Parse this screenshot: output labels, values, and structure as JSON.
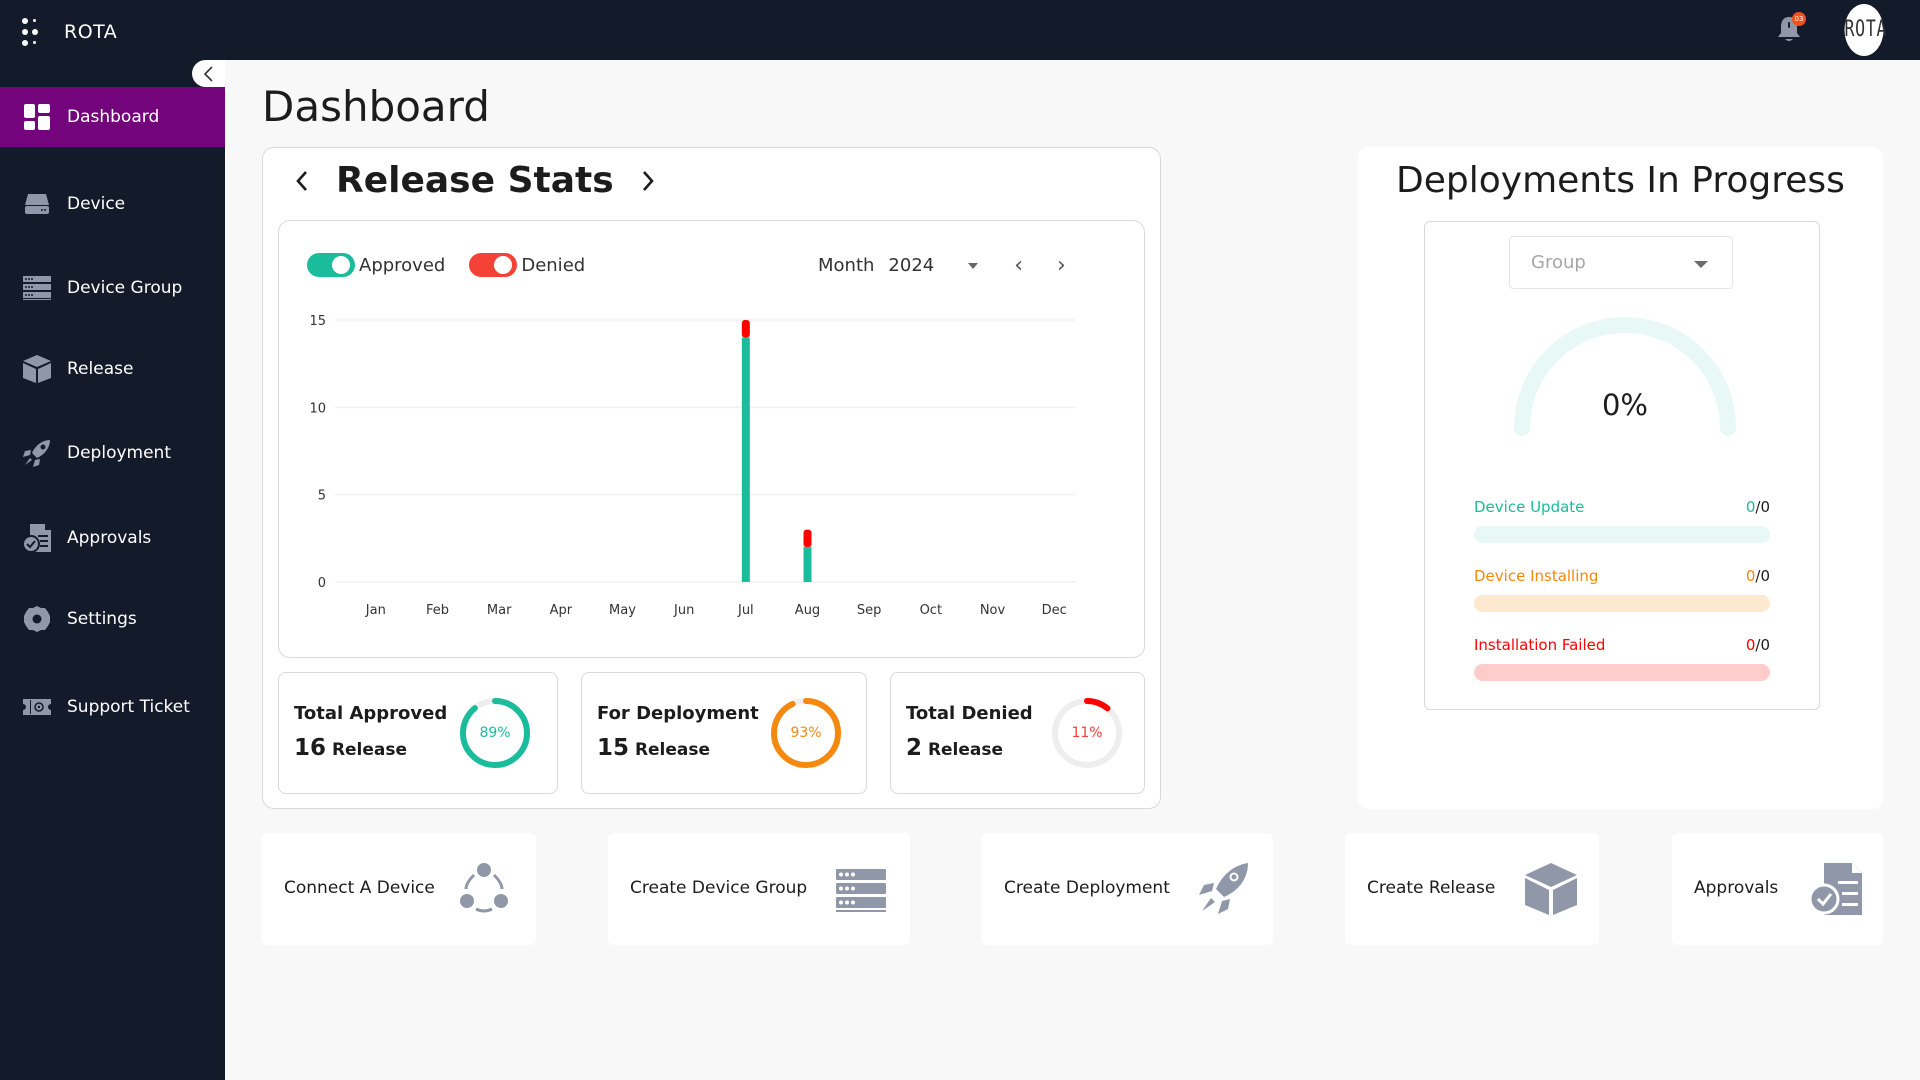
{
  "app": {
    "brand": "ROTA",
    "avatar_text": "ROTA",
    "notification_count": "03"
  },
  "sidebar": {
    "items": [
      {
        "label": "Dashboard",
        "icon": "dashboard-icon",
        "active": true
      },
      {
        "label": "Device",
        "icon": "device-icon",
        "active": false
      },
      {
        "label": "Device Group",
        "icon": "device-group-icon",
        "active": false
      },
      {
        "label": "Release",
        "icon": "release-box-icon",
        "active": false
      },
      {
        "label": "Deployment",
        "icon": "rocket-icon",
        "active": false
      },
      {
        "label": "Approvals",
        "icon": "approvals-icon",
        "active": false
      },
      {
        "label": "Settings",
        "icon": "gear-icon",
        "active": false
      },
      {
        "label": "Support Ticket",
        "icon": "ticket-icon",
        "active": false
      }
    ]
  },
  "page": {
    "title": "Dashboard"
  },
  "release_stats": {
    "title": "Release Stats",
    "legend": {
      "approved": "Approved",
      "denied": "Denied"
    },
    "period_label": "Month",
    "year": "2024",
    "cards": [
      {
        "label": "Total Approved",
        "count": "16",
        "unit": "Release",
        "percent": 89,
        "percent_text": "89%",
        "color": "#1abc9c"
      },
      {
        "label": "For Deployment",
        "count": "15",
        "unit": "Release",
        "percent": 93,
        "percent_text": "93%",
        "color": "#f5880f"
      },
      {
        "label": "Total Denied",
        "count": "2",
        "unit": "Release",
        "percent": 11,
        "percent_text": "11%",
        "color": "#ff0000"
      }
    ]
  },
  "chart_data": {
    "type": "bar",
    "stacked": true,
    "title": "Release Stats",
    "categories": [
      "Jan",
      "Feb",
      "Mar",
      "Apr",
      "May",
      "Jun",
      "Jul",
      "Aug",
      "Sep",
      "Oct",
      "Nov",
      "Dec"
    ],
    "series": [
      {
        "name": "Approved",
        "color": "#1abc9c",
        "values": [
          0,
          0,
          0,
          0,
          0,
          0,
          14,
          2,
          0,
          0,
          0,
          0
        ]
      },
      {
        "name": "Denied",
        "color": "#ff0000",
        "values": [
          0,
          0,
          0,
          0,
          0,
          0,
          1,
          1,
          0,
          0,
          0,
          0
        ]
      }
    ],
    "yticks": [
      0,
      5,
      10,
      15
    ],
    "ylim": [
      0,
      15
    ],
    "xlabel": "",
    "ylabel": "",
    "grid": true,
    "legend": "top-left"
  },
  "deployments": {
    "title": "Deployments In Progress",
    "group_placeholder": "Group",
    "gauge_percent": 0,
    "gauge_text": "0%",
    "progress": [
      {
        "label": "Device Update",
        "done": "0",
        "total": "0",
        "fraction": 0,
        "color": "#1abc9c",
        "track": "#e8f8f5"
      },
      {
        "label": "Device Installing",
        "done": "0",
        "total": "0",
        "fraction": 0,
        "color": "#f5880f",
        "track": "#fde8d0"
      },
      {
        "label": "Installation Failed",
        "done": "0",
        "total": "0",
        "fraction": 0,
        "color": "#ff0000",
        "track": "#ffcccc"
      }
    ]
  },
  "quick_actions": [
    {
      "label": "Connect A Device",
      "icon": "connect-device-icon"
    },
    {
      "label": "Create Device Group",
      "icon": "device-group-icon"
    },
    {
      "label": "Create Deployment",
      "icon": "rocket-icon"
    },
    {
      "label": "Create Release",
      "icon": "release-box-icon"
    },
    {
      "label": "Approvals",
      "icon": "approvals-icon"
    }
  ],
  "colors": {
    "topbar": "#131a29",
    "active_nav": "#74047c",
    "approved": "#1abc9c",
    "denied": "#ff0000",
    "deployment": "#f5880f",
    "icon_gray": "#8f97a8"
  }
}
